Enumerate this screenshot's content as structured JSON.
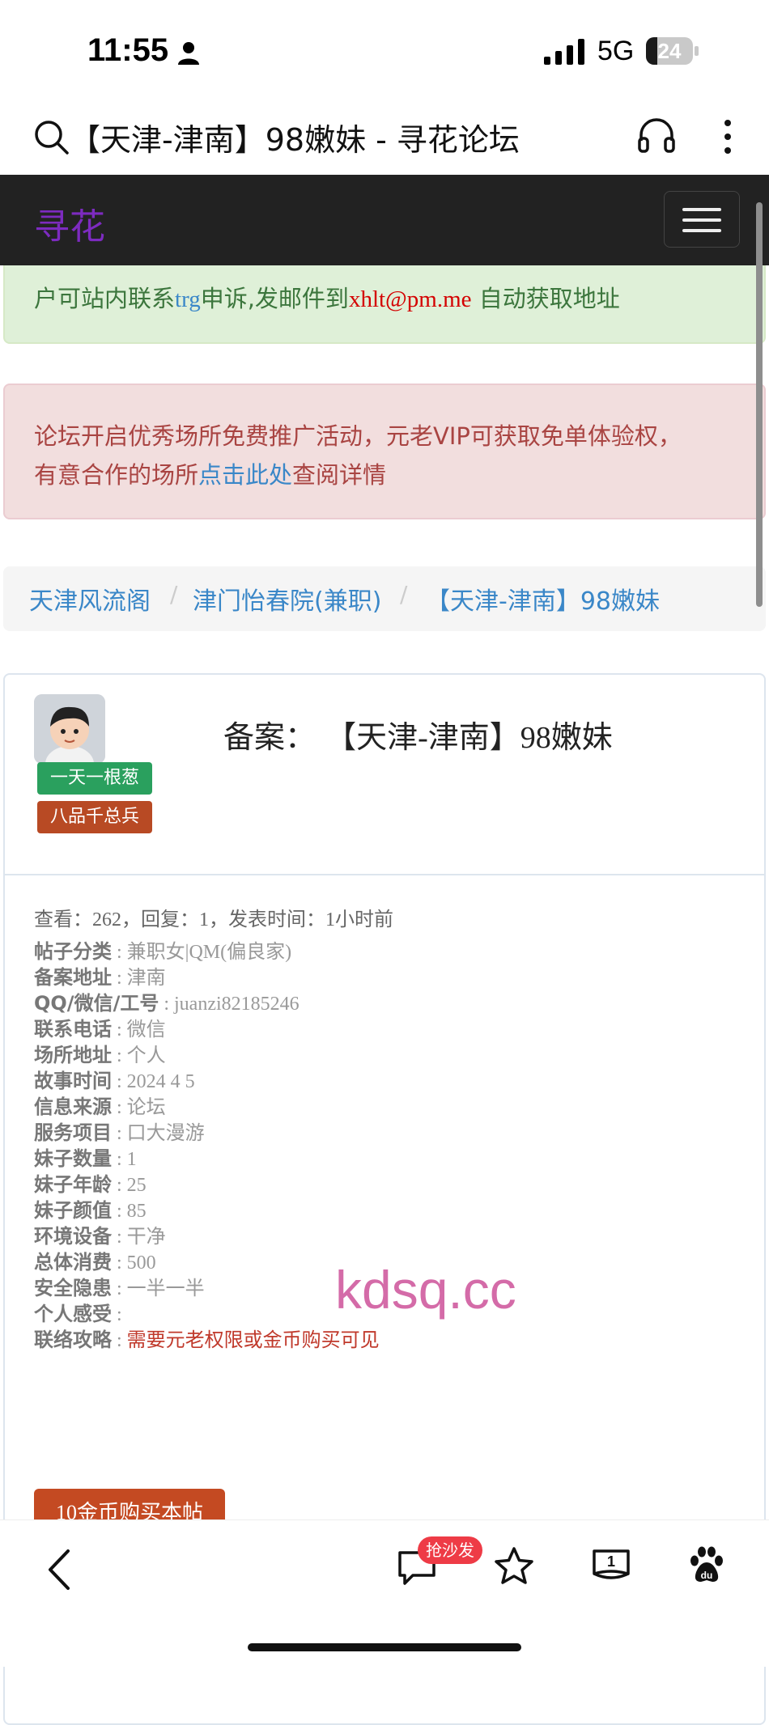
{
  "status_bar": {
    "time": "11:55",
    "network": "5G",
    "battery": "24",
    "battery_level": 0.24
  },
  "browser": {
    "page_title": "【天津-津南】98嫩妹 - 寻花论坛"
  },
  "navbar": {
    "brand": "寻花"
  },
  "notice_green": {
    "prefix": "户可站内联系",
    "contact": "trg",
    "middle": "申诉,发邮件到",
    "email": "xhlt@pm.me",
    "suffix": " 自动获取地址"
  },
  "notice_red": {
    "line1": "论坛开启优秀场所免费推广活动，元老VIP可获取免单体验权，",
    "line2_prefix": "有意合作的场所",
    "line2_link": "点击此处",
    "line2_suffix": "查阅详情"
  },
  "breadcrumb": {
    "items": [
      "天津风流阁",
      "津门怡春院(兼职)",
      "【天津-津南】98嫩妹"
    ],
    "separator": "/"
  },
  "post": {
    "user_badges": [
      "一天一根葱",
      "八品千总兵"
    ],
    "title_label": "备案：",
    "title": "【天津-津南】98嫩妹",
    "stats": {
      "views_label": "查看：",
      "views": "262",
      "replies_label": "，回复：",
      "replies": "1",
      "time_label": "，发表时间：",
      "time": "1小时前"
    },
    "fields": [
      {
        "key": "帖子分类",
        "value": "兼职女|QM(偏良家)"
      },
      {
        "key": "备案地址",
        "value": "津南"
      },
      {
        "key": "QQ/微信/工号",
        "value": "juanzi82185246"
      },
      {
        "key": "联系电话",
        "value": "微信"
      },
      {
        "key": "场所地址",
        "value": "个人"
      },
      {
        "key": "故事时间",
        "value": "2024 4 5"
      },
      {
        "key": "信息来源",
        "value": "论坛"
      },
      {
        "key": "服务项目",
        "value": "口大漫游"
      },
      {
        "key": "妹子数量",
        "value": "1"
      },
      {
        "key": "妹子年龄",
        "value": "25"
      },
      {
        "key": "妹子颜值",
        "value": "85"
      },
      {
        "key": "环境设备",
        "value": "干净"
      },
      {
        "key": "总体消费",
        "value": "500"
      },
      {
        "key": "安全隐患",
        "value": "一半一半"
      },
      {
        "key": "个人感受",
        "value": ""
      },
      {
        "key": "联络攻略",
        "value": "需要元老权限或金币购买可见"
      }
    ],
    "field_separator": " : ",
    "buy_button": "10金币购买本帖"
  },
  "watermark": "kdsq.cc",
  "bottom_toolbar": {
    "hot_badge": "抢沙发",
    "tabs_count": "1"
  }
}
